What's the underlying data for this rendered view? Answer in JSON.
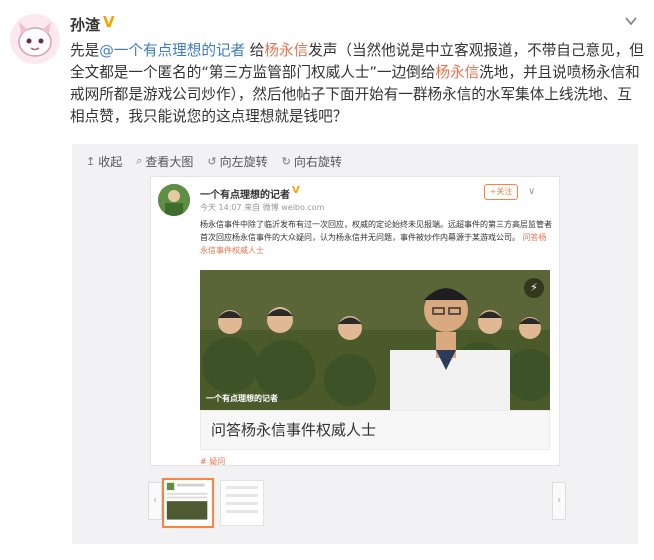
{
  "header": {
    "username": "孙渣",
    "verified_badge": "V",
    "chevron": "chevron-down-icon"
  },
  "post": {
    "p1": "先是",
    "mention": "@一个有点理想的记者",
    "p2": " 给",
    "name1": "杨永信",
    "p3": "发声（当然他说是中立客观报道，不带自己意见，但全文都是一个匿名的“第三方监管部门权威人士”一边倒给",
    "name2": "杨永信",
    "p4": "洗地，并且说喷杨永信和戒网所都是游戏公司炒作），然后他帖子下面开始有一群杨永信的水军集体上线洗地、互相点赞，我只能说您的这点理想就是钱吧？"
  },
  "toolbar": {
    "collect": "收起",
    "view_large": "查看大图",
    "rotate_left": "向左旋转",
    "rotate_right": "向右旋转"
  },
  "screenshot": {
    "author": "一个有点理想的记者",
    "author_badge": "V",
    "meta": "今天 14:07 来自 微博 weibo.com",
    "follow": "+关注",
    "more": "∨",
    "text_main": "杨永信事件中除了临沂发布有过一次回应，权威的定论始终未见报端。远超事件的第三方高层监管者首次回应杨永信事件的大众疑问，认为杨永信并无问题，事件被炒作内幕源于某游戏公司。",
    "text_link": "问答杨永信事件权威人士",
    "photo_caption": "一个有点理想的记者",
    "card_title": "问答杨永信事件权威人士",
    "topic": "# 疑问"
  },
  "colors": {
    "link": "#eb7350",
    "mention": "#3c7cbf",
    "badge": "#f4a300",
    "card_bg": "#f2f2f5"
  }
}
